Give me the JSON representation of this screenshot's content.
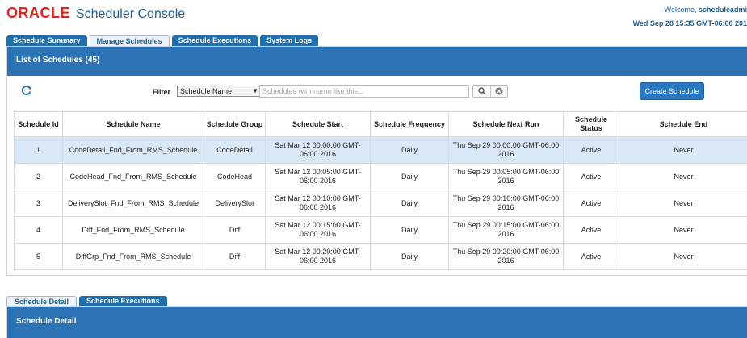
{
  "brand": {
    "logo": "ORACLE",
    "title": "Scheduler Console"
  },
  "user": {
    "welcome_prefix": "Welcome, ",
    "username": "scheduleadmi",
    "datetime": "Wed Sep 28 15:35 GMT-06:00 201"
  },
  "tabs": [
    {
      "label": "Schedule Summary",
      "active": false
    },
    {
      "label": "Manage Schedules",
      "active": true
    },
    {
      "label": "Schedule Executions",
      "active": false
    },
    {
      "label": "System Logs",
      "active": false
    }
  ],
  "list_panel": {
    "title": "List of Schedules (45)",
    "filter_label": "Filter",
    "filter_value": "Schedule Name",
    "search_placeholder": "Schedules with name like this...",
    "create_label": "Create Schedule"
  },
  "table": {
    "headers": [
      "Schedule Id",
      "Schedule Name",
      "Schedule Group",
      "Schedule Start",
      "Schedule Frequency",
      "Schedule Next Run",
      "Schedule Status",
      "Schedule End"
    ],
    "rows": [
      [
        "1",
        "CodeDetail_Fnd_From_RMS_Schedule",
        "CodeDetail",
        "Sat Mar 12 00:00:00 GMT-06:00 2016",
        "Daily",
        "Thu Sep 29 00:00:00 GMT-06:00 2016",
        "Active",
        "Never"
      ],
      [
        "2",
        "CodeHead_Fnd_From_RMS_Schedule",
        "CodeHead",
        "Sat Mar 12 00:05:00 GMT-06:00 2016",
        "Daily",
        "Thu Sep 29 00:05:00 GMT-06:00 2016",
        "Active",
        "Never"
      ],
      [
        "3",
        "DeliverySlot_Fnd_From_RMS_Schedule",
        "DeliverySlot",
        "Sat Mar 12 00:10:00 GMT-06:00 2016",
        "Daily",
        "Thu Sep 29 00:10:00 GMT-06:00 2016",
        "Active",
        "Never"
      ],
      [
        "4",
        "Diff_Fnd_From_RMS_Schedule",
        "Diff",
        "Sat Mar 12 00:15:00 GMT-06:00 2016",
        "Daily",
        "Thu Sep 29 00:15:00 GMT-06:00 2016",
        "Active",
        "Never"
      ],
      [
        "5",
        "DiffGrp_Fnd_From_RMS_Schedule",
        "Diff",
        "Sat Mar 12 00:20:00 GMT-06:00 2016",
        "Daily",
        "Thu Sep 29 00:20:00 GMT-06:00 2016",
        "Active",
        "Never"
      ]
    ],
    "selected_row": 0
  },
  "detail_tabs": [
    {
      "label": "Schedule Detail",
      "active": true
    },
    {
      "label": "Schedule Executions",
      "active": false
    }
  ],
  "detail_panel": {
    "title": "Schedule Detail"
  },
  "icons": {
    "refresh": "refresh-icon",
    "search": "search-icon",
    "clear": "clear-icon",
    "dropdown": "chevron-down-icon"
  },
  "colors": {
    "brand_red": "#e2231a",
    "brand_blue": "#1f5f93",
    "panel_header": "#2c73b5",
    "selected_row": "#dbe8f7"
  }
}
